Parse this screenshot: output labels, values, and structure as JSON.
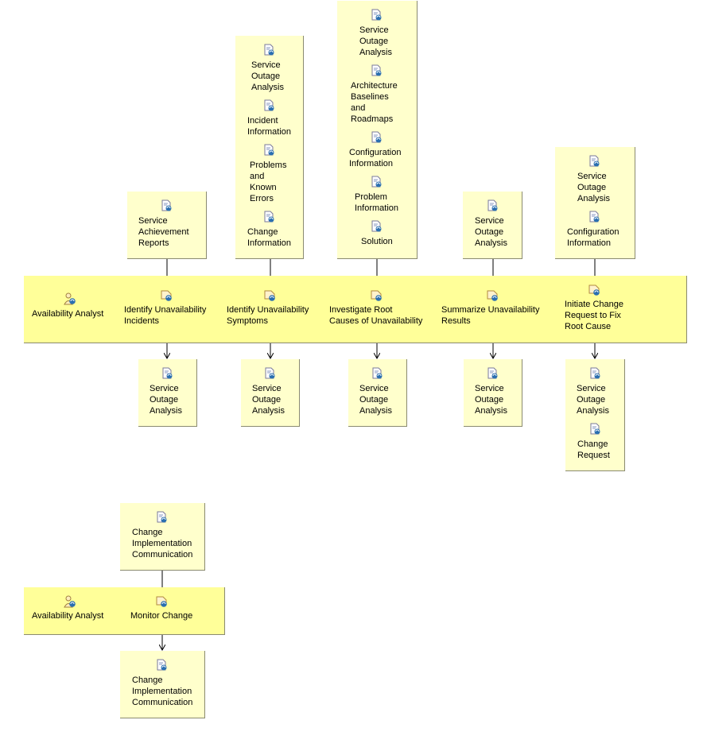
{
  "diagram_1": {
    "role": {
      "label": "Availability Analyst",
      "icon": "role-icon"
    },
    "tasks": [
      {
        "label": "Identify Unavailability\nIncidents",
        "icon": "task-icon",
        "inputs": [
          "Service\nAchievement\nReports"
        ],
        "outputs": [
          "Service\nOutage\nAnalysis"
        ]
      },
      {
        "label": "Identify Unavailability\nSymptoms",
        "icon": "task-icon",
        "inputs": [
          "Service\nOutage\nAnalysis",
          "Incident\nInformation",
          "Problems\nand\nKnown\nErrors",
          "Change\nInformation"
        ],
        "outputs": [
          "Service\nOutage\nAnalysis"
        ]
      },
      {
        "label": "Investigate Root\nCauses of Unavailability",
        "icon": "task-icon",
        "inputs": [
          "Service\nOutage\nAnalysis",
          "Architecture\nBaselines\nand\nRoadmaps",
          "Configuration\nInformation",
          "Problem\nInformation",
          "Solution"
        ],
        "outputs": [
          "Service\nOutage\nAnalysis"
        ]
      },
      {
        "label": "Summarize Unavailability\nResults",
        "icon": "task-icon",
        "inputs": [
          "Service\nOutage\nAnalysis"
        ],
        "outputs": [
          "Service\nOutage\nAnalysis"
        ]
      },
      {
        "label": "Initiate Change\nRequest to Fix\nRoot Cause",
        "icon": "task-icon",
        "inputs": [
          "Service\nOutage\nAnalysis",
          "Configuration\nInformation"
        ],
        "outputs": [
          "Service\nOutage\nAnalysis",
          "Change\nRequest"
        ]
      }
    ]
  },
  "diagram_2": {
    "role": {
      "label": "Availability Analyst",
      "icon": "role-icon"
    },
    "tasks": [
      {
        "label": "Monitor Change",
        "icon": "task-icon",
        "inputs": [
          "Change\nImplementation\nCommunication"
        ],
        "outputs": [
          "Change\nImplementation\nCommunication"
        ]
      }
    ]
  },
  "colors": {
    "lane": "#ffff99",
    "artifact": "#ffffcc",
    "border": "#8a8a70"
  }
}
